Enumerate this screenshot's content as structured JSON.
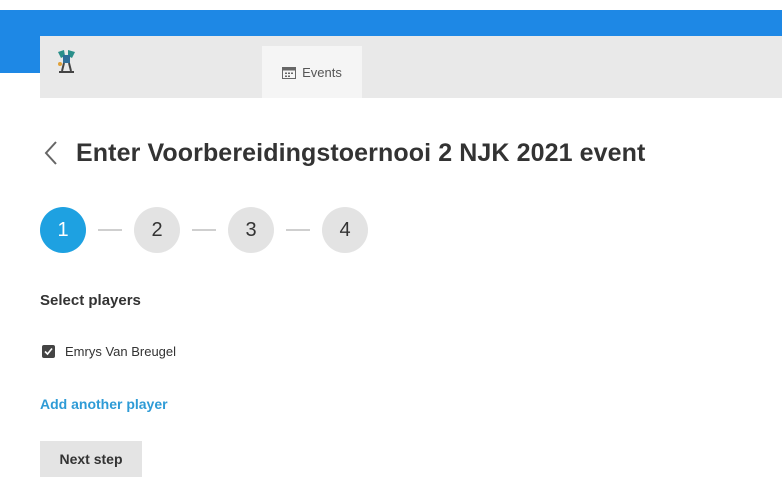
{
  "nav": {
    "logo_icon": "team-logo-icon",
    "tabs": [
      {
        "label": "Events",
        "icon": "calendar-icon",
        "active": true
      }
    ]
  },
  "header": {
    "back_icon": "chevron-left-icon",
    "title": "Enter Voorbereidingstoernooi 2 NJK 2021 event"
  },
  "stepper": {
    "steps": [
      "1",
      "2",
      "3",
      "4"
    ],
    "current": 1
  },
  "players": {
    "section_label": "Select players",
    "items": [
      {
        "name": "Emrys Van Breugel",
        "checked": true
      }
    ],
    "add_label": "Add another player"
  },
  "actions": {
    "next_label": "Next step"
  },
  "colors": {
    "top_bar": "#1e88e5",
    "nav_bar": "#e9e9e9",
    "active_step": "#1ea1e1",
    "link": "#2e9bd6"
  }
}
